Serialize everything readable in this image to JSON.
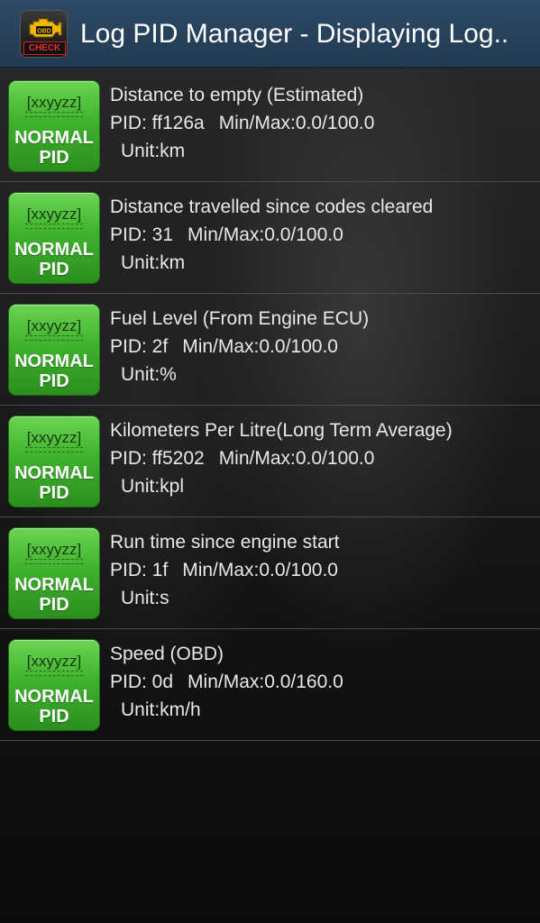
{
  "app": {
    "title": "Log PID Manager - Displaying Log..",
    "icon_name": "obd-check-engine-icon",
    "icon_top_text": "OBD",
    "icon_bottom_text": "CHECK"
  },
  "colors": {
    "action_bar": "#2d4a66",
    "badge_green": "#3fb12e",
    "check_red": "#e83030"
  },
  "pids": [
    {
      "badge_code": "[xxyyzz]",
      "badge_type_line1": "NORMAL",
      "badge_type_line2": "PID",
      "name": "Distance to empty (Estimated)",
      "pid": "PID: ff126a",
      "minmax": "Min/Max:0.0/100.0",
      "unit": "Unit:km"
    },
    {
      "badge_code": "[xxyyzz]",
      "badge_type_line1": "NORMAL",
      "badge_type_line2": "PID",
      "name": "Distance travelled since codes cleared",
      "pid": "PID: 31",
      "minmax": "Min/Max:0.0/100.0",
      "unit": "Unit:km"
    },
    {
      "badge_code": "[xxyyzz]",
      "badge_type_line1": "NORMAL",
      "badge_type_line2": "PID",
      "name": "Fuel Level (From Engine ECU)",
      "pid": "PID: 2f",
      "minmax": "Min/Max:0.0/100.0",
      "unit": "Unit:%"
    },
    {
      "badge_code": "[xxyyzz]",
      "badge_type_line1": "NORMAL",
      "badge_type_line2": "PID",
      "name": "Kilometers Per Litre(Long Term Average)",
      "pid": "PID: ff5202",
      "minmax": "Min/Max:0.0/100.0",
      "unit": "Unit:kpl"
    },
    {
      "badge_code": "[xxyyzz]",
      "badge_type_line1": "NORMAL",
      "badge_type_line2": "PID",
      "name": "Run time since engine start",
      "pid": "PID: 1f",
      "minmax": "Min/Max:0.0/100.0",
      "unit": "Unit:s"
    },
    {
      "badge_code": "[xxyyzz]",
      "badge_type_line1": "NORMAL",
      "badge_type_line2": "PID",
      "name": "Speed (OBD)",
      "pid": "PID: 0d",
      "minmax": "Min/Max:0.0/160.0",
      "unit": "Unit:km/h"
    }
  ]
}
